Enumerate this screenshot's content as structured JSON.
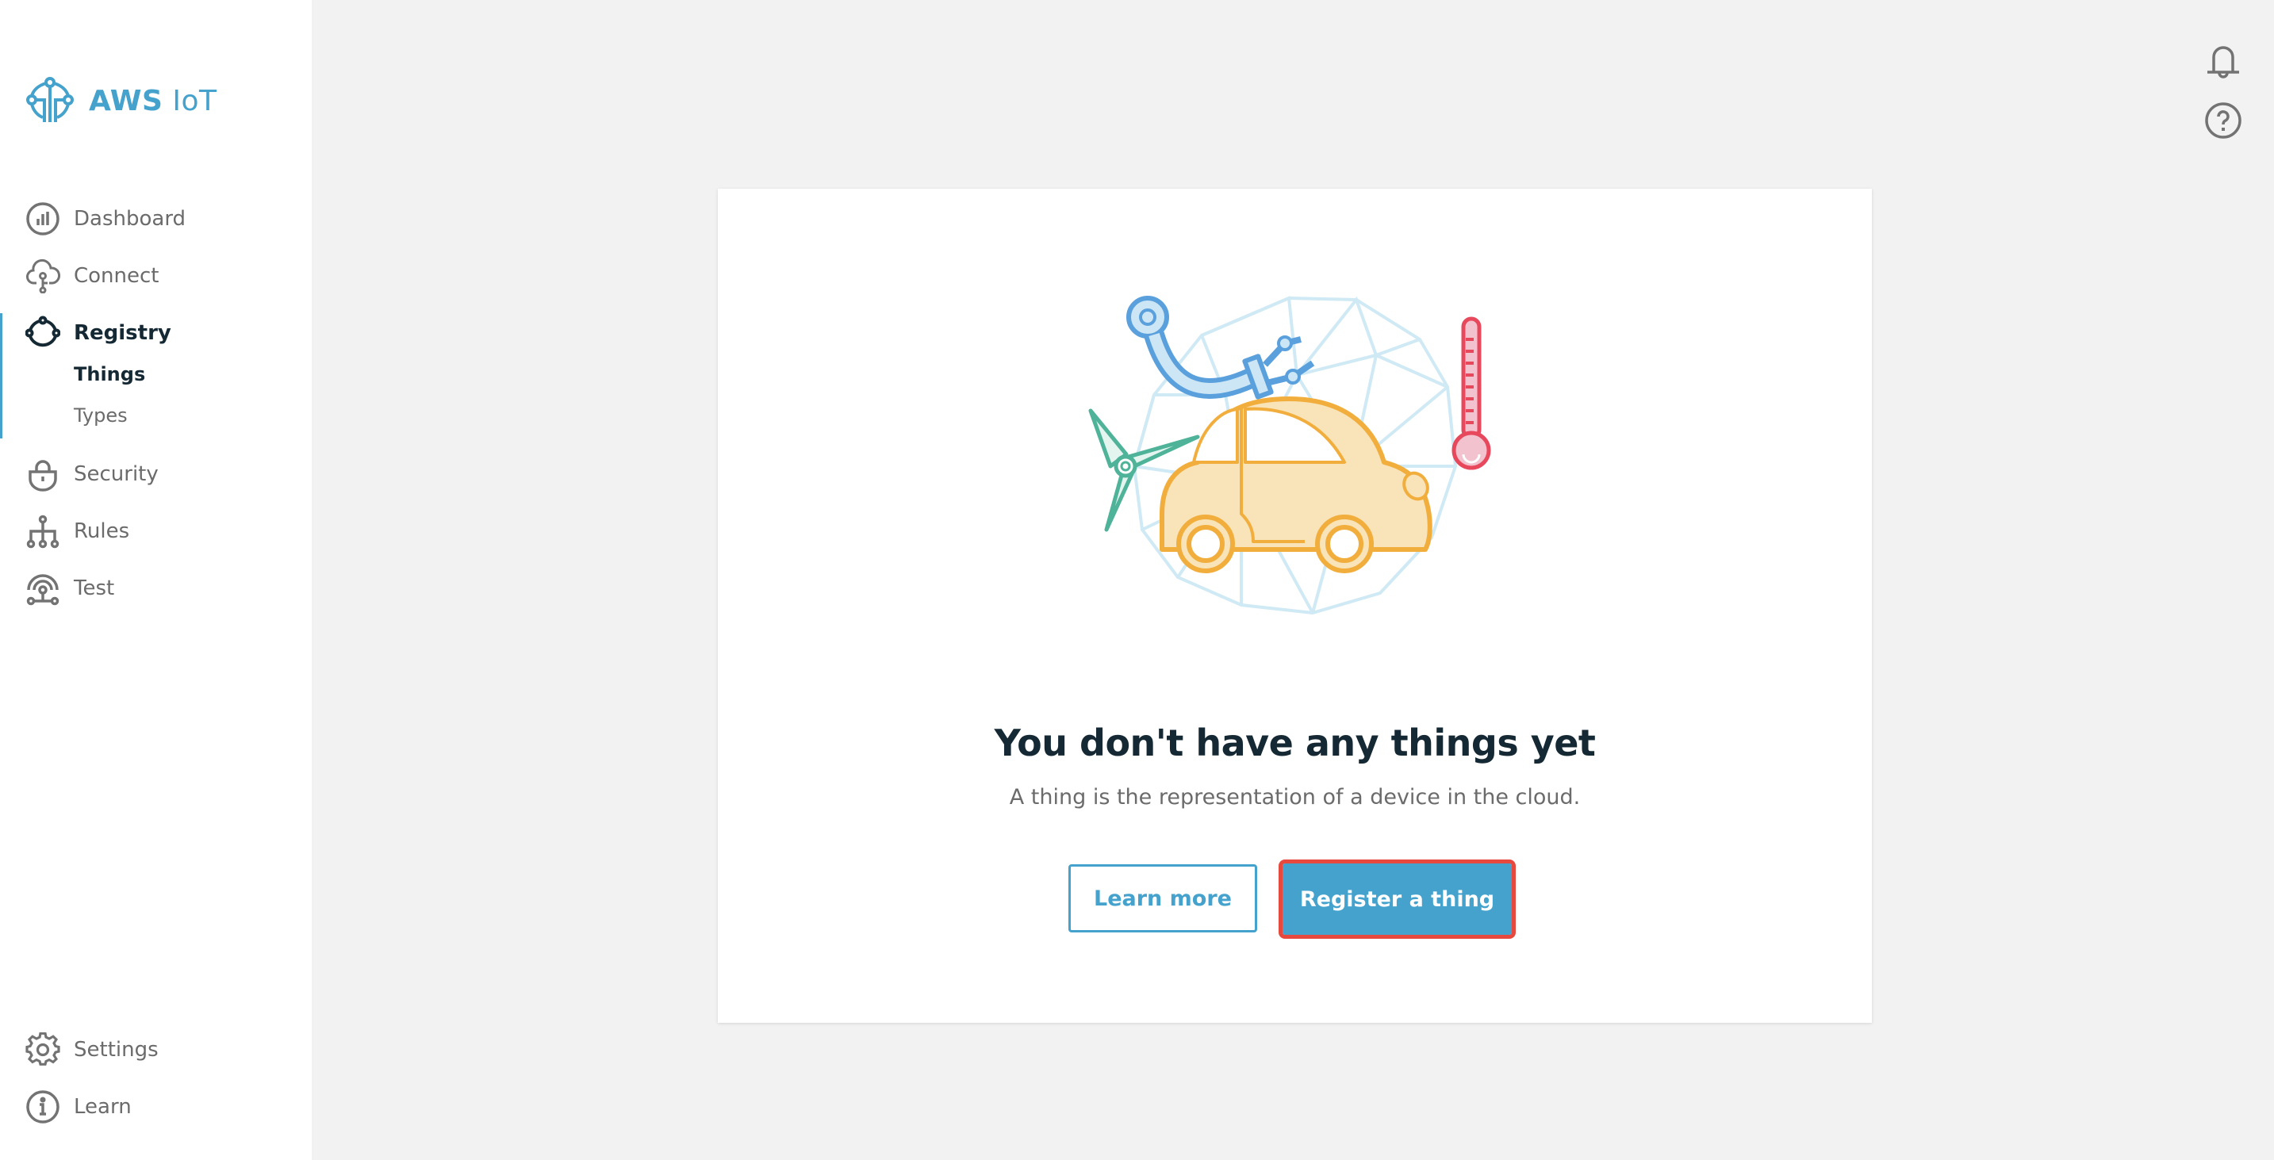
{
  "app": {
    "brand_bold": "AWS",
    "brand_light": "IoT",
    "accent_color": "#44a2cd",
    "highlight_color": "#e8493e"
  },
  "sidebar": {
    "items": [
      {
        "label": "Dashboard",
        "icon": "dashboard-icon",
        "active": false
      },
      {
        "label": "Connect",
        "icon": "cloud-connect-icon",
        "active": false
      },
      {
        "label": "Registry",
        "icon": "registry-icon",
        "active": true,
        "children": [
          {
            "label": "Things",
            "active": true
          },
          {
            "label": "Types",
            "active": false
          }
        ]
      },
      {
        "label": "Security",
        "icon": "lock-icon",
        "active": false
      },
      {
        "label": "Rules",
        "icon": "rules-tree-icon",
        "active": false
      },
      {
        "label": "Test",
        "icon": "test-signal-icon",
        "active": false
      }
    ],
    "bottom_items": [
      {
        "label": "Settings",
        "icon": "gear-icon"
      },
      {
        "label": "Learn",
        "icon": "info-icon"
      }
    ]
  },
  "header": {
    "icons": [
      "bell-icon",
      "help-icon"
    ]
  },
  "empty_state": {
    "illustration": "iot-devices-illustration",
    "title": "You don't have any things yet",
    "subtitle": "A thing is the representation of a device in the cloud.",
    "secondary_button": "Learn more",
    "primary_button": "Register a thing"
  }
}
